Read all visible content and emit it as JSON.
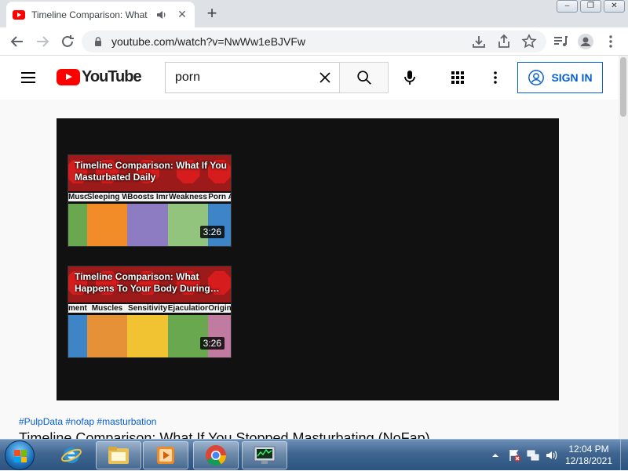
{
  "browser": {
    "tab": {
      "title": "Timeline Comparison: What If You Stopped Masturbating (NoFap)",
      "icon": "youtube-icon",
      "audio_icon": "speaker-icon"
    },
    "new_tab_label": "+",
    "window_controls": {
      "minimize": "–",
      "restore": "❐",
      "close": "✕"
    },
    "url": "youtube.com/watch?v=NwWw1eBJVFw"
  },
  "youtube": {
    "logo_text": "YouTube",
    "search": {
      "query": "porn"
    },
    "signin_label": "SIGN IN",
    "brand_color": "#ff0000",
    "accent_color": "#065fd4"
  },
  "player": {
    "end_cards": [
      {
        "title": "Timeline Comparison: What If You Masturbated Daily",
        "duration": "3:26",
        "panels": [
          {
            "label": "Muscle",
            "color": "#6aa84f"
          },
          {
            "label": "Sleeping Well",
            "color": "#f28c28"
          },
          {
            "label": "Boosts Immune System",
            "color": "#8e7cc3"
          },
          {
            "label": "Weakness",
            "color": "#93c47d"
          },
          {
            "label": "Porn A",
            "color": "#3d85c6"
          }
        ]
      },
      {
        "title": "Timeline Comparison: What Happens To Your Body During…",
        "duration": "3:26",
        "panels": [
          {
            "label": "ment",
            "color": "#3d85c6"
          },
          {
            "label": "Muscles",
            "color": "#e69138"
          },
          {
            "label": "Sensitivity",
            "color": "#f1c232"
          },
          {
            "label": "Ejaculation",
            "color": "#6aa84f"
          },
          {
            "label": "Origin",
            "color": "#c27ba0"
          }
        ]
      }
    ]
  },
  "video": {
    "hashtags": "#PulpData #nofap #masturbation",
    "title": "Timeline Comparison: What If You Stopped Masturbating (NoFap)"
  },
  "taskbar": {
    "clock_time": "12:04 PM",
    "clock_date": "12/18/2021",
    "pinned": [
      "internet-explorer-icon",
      "windows-explorer-icon",
      "media-player-icon",
      "chrome-icon",
      "task-manager-icon"
    ]
  }
}
